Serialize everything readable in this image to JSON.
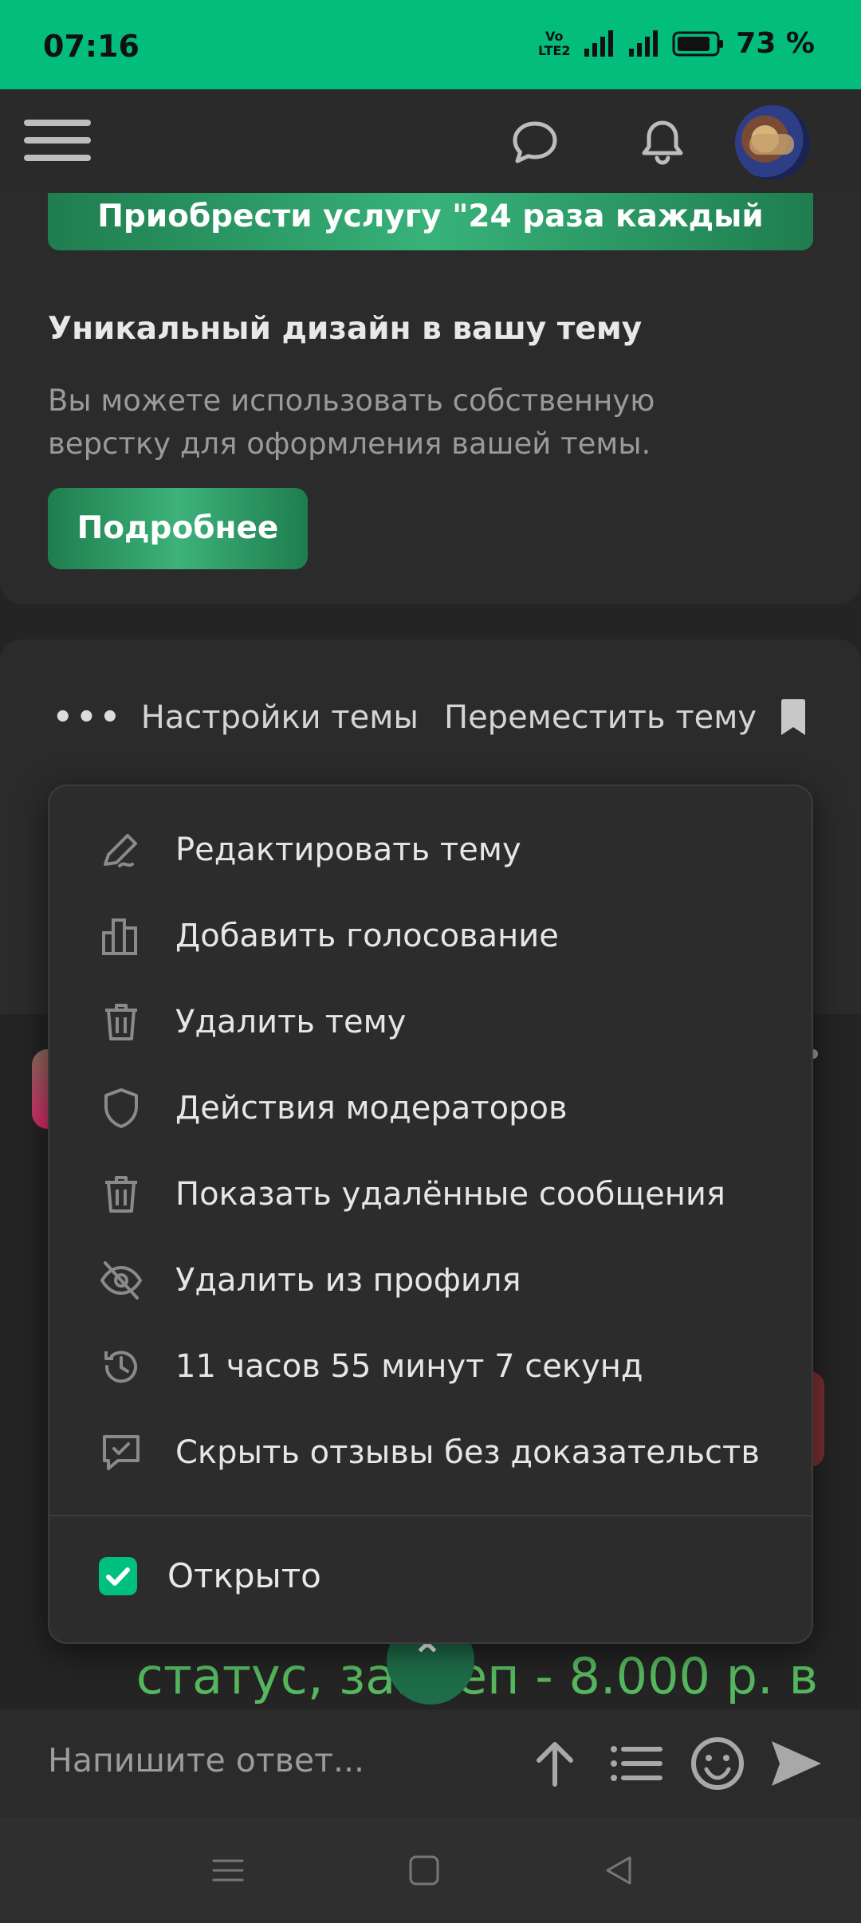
{
  "status_bar": {
    "time": "07:16",
    "volte_top": "Vo",
    "volte_bottom": "LTE2",
    "battery": "73 %"
  },
  "top_bar": {
    "menu_icon": "hamburger-icon",
    "chat_icon": "chat-bubble-icon",
    "bell_icon": "bell-icon"
  },
  "promo": {
    "button_label": "Приобрести услугу \"24 раза каждый",
    "feature_title": "Уникальный дизайн в вашу тему",
    "feature_description": "Вы можете использовать собственную верстку для оформления вашей темы.",
    "more_label": "Подробнее"
  },
  "thread_toolbar": {
    "dots": "•••",
    "settings_label": "Настройки темы",
    "move_label": "Переместить тему"
  },
  "menu": {
    "items": [
      {
        "label": "Редактировать тему",
        "icon": "pencil-icon"
      },
      {
        "label": "Добавить голосование",
        "icon": "poll-icon"
      },
      {
        "label": "Удалить тему",
        "icon": "trash-icon"
      },
      {
        "label": "Действия модераторов",
        "icon": "shield-icon"
      },
      {
        "label": "Показать удалённые сообщения",
        "icon": "trash-icon"
      },
      {
        "label": "Удалить из профиля",
        "icon": "eye-off-icon"
      },
      {
        "label": "11 часов 55 минут 7 секунд",
        "icon": "history-icon"
      },
      {
        "label": "Скрыть отзывы без доказательств",
        "icon": "chat-check-icon"
      }
    ],
    "open_checkbox_label": "Открыто",
    "open_checked": true
  },
  "background": {
    "green_text": "статус, закреп - 8.000 р. в",
    "comma": ","
  },
  "reply": {
    "placeholder": "Напишите ответ..."
  },
  "colors": {
    "accent": "#02bd7b",
    "button_green": "#2a9d63",
    "text_green": "#56b85e"
  }
}
